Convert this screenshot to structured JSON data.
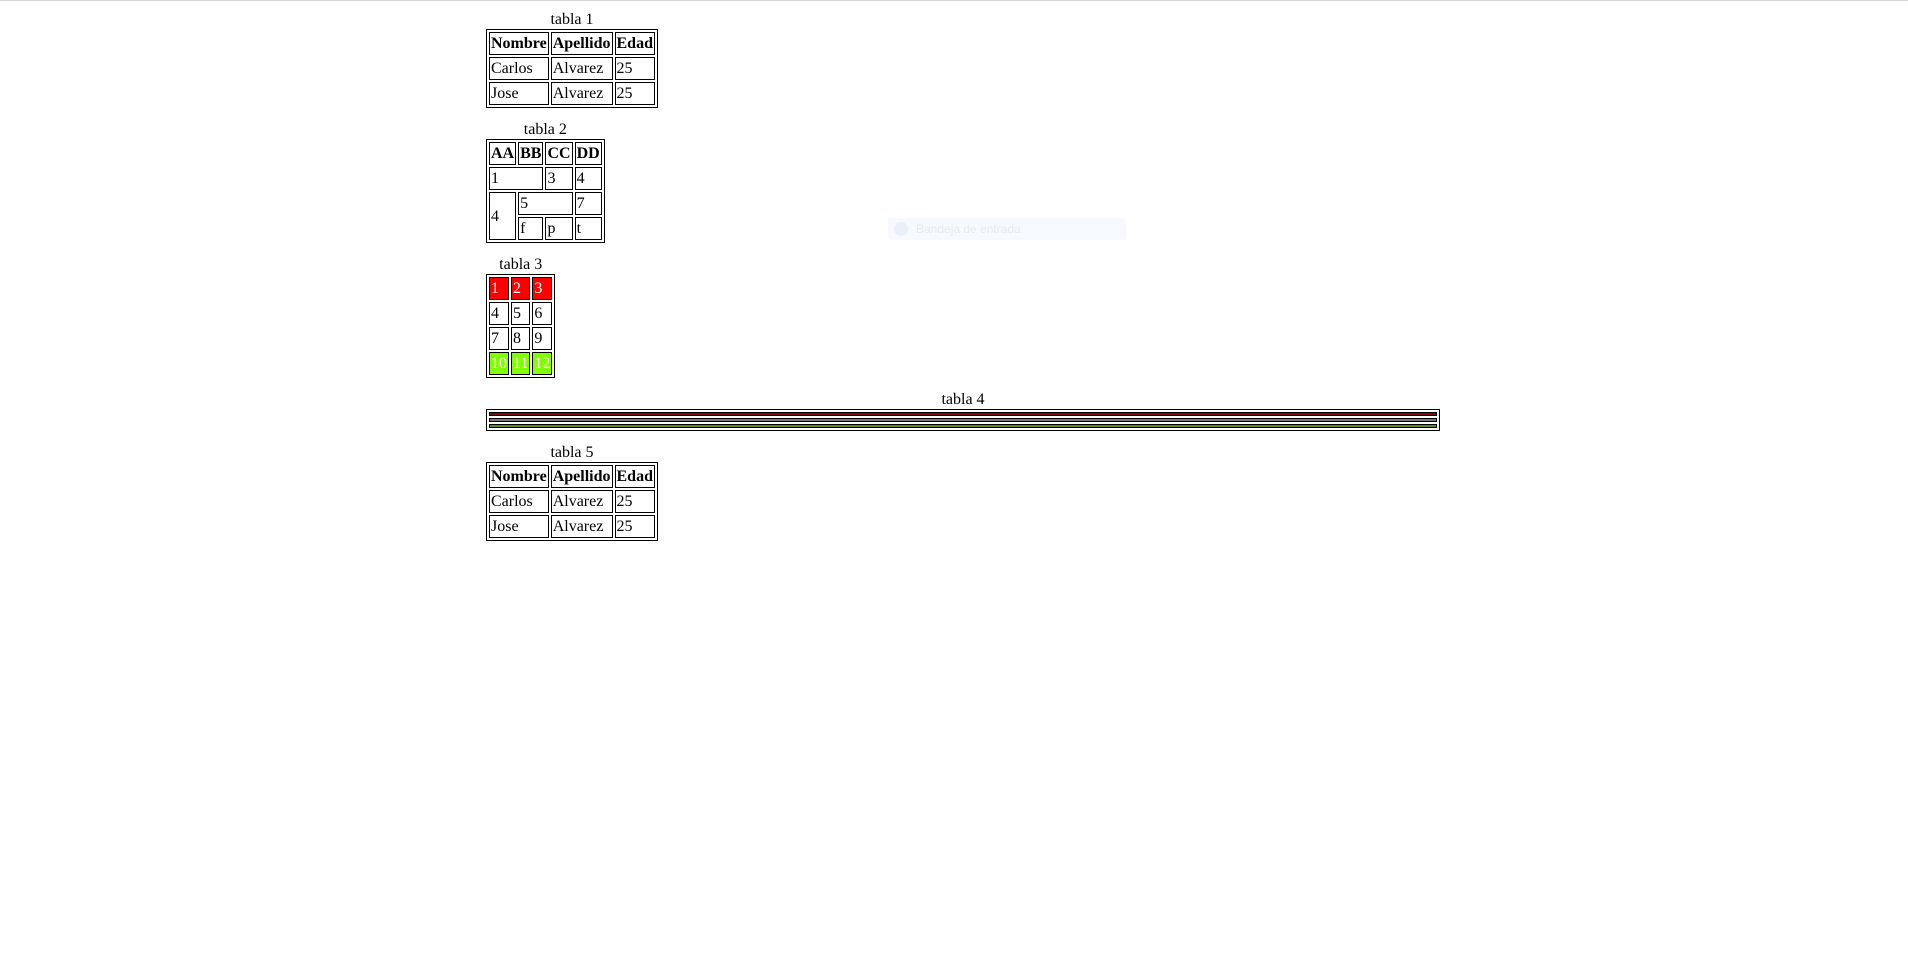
{
  "tabla1": {
    "caption": "tabla 1",
    "headers": [
      "Nombre",
      "Apellido",
      "Edad"
    ],
    "rows": [
      [
        "Carlos",
        "Alvarez",
        "25"
      ],
      [
        "Jose",
        "Alvarez",
        "25"
      ]
    ]
  },
  "tabla2": {
    "caption": "tabla 2",
    "headers": [
      "AA",
      "BB",
      "CC",
      "DD"
    ],
    "r1": [
      "1",
      "3",
      "4"
    ],
    "r2": [
      "4",
      "5",
      "7"
    ],
    "r3": [
      "f",
      "p",
      "t"
    ]
  },
  "tabla3": {
    "caption": "tabla 3",
    "rows": [
      [
        "1",
        "2",
        "3"
      ],
      [
        "4",
        "5",
        "6"
      ],
      [
        "7",
        "8",
        "9"
      ],
      [
        "10",
        "11",
        "12"
      ]
    ],
    "colors": {
      "row1_bg": "#ff0000",
      "row4_bg": "#7fff00",
      "text": "#ffffff"
    }
  },
  "tabla4": {
    "caption": "tabla 4",
    "colors": {
      "row1": "#7a0d0d",
      "row2": "#777777",
      "row3": "#5a8a2a"
    }
  },
  "tabla5": {
    "caption": "tabla 5",
    "headers": [
      "Nombre",
      "Apellido",
      "Edad"
    ],
    "rows": [
      [
        "Carlos",
        "Alvarez",
        "25"
      ],
      [
        "Jose",
        "Alvarez",
        "25"
      ]
    ]
  },
  "overlay": {
    "text": "Bandeja de entrada"
  }
}
